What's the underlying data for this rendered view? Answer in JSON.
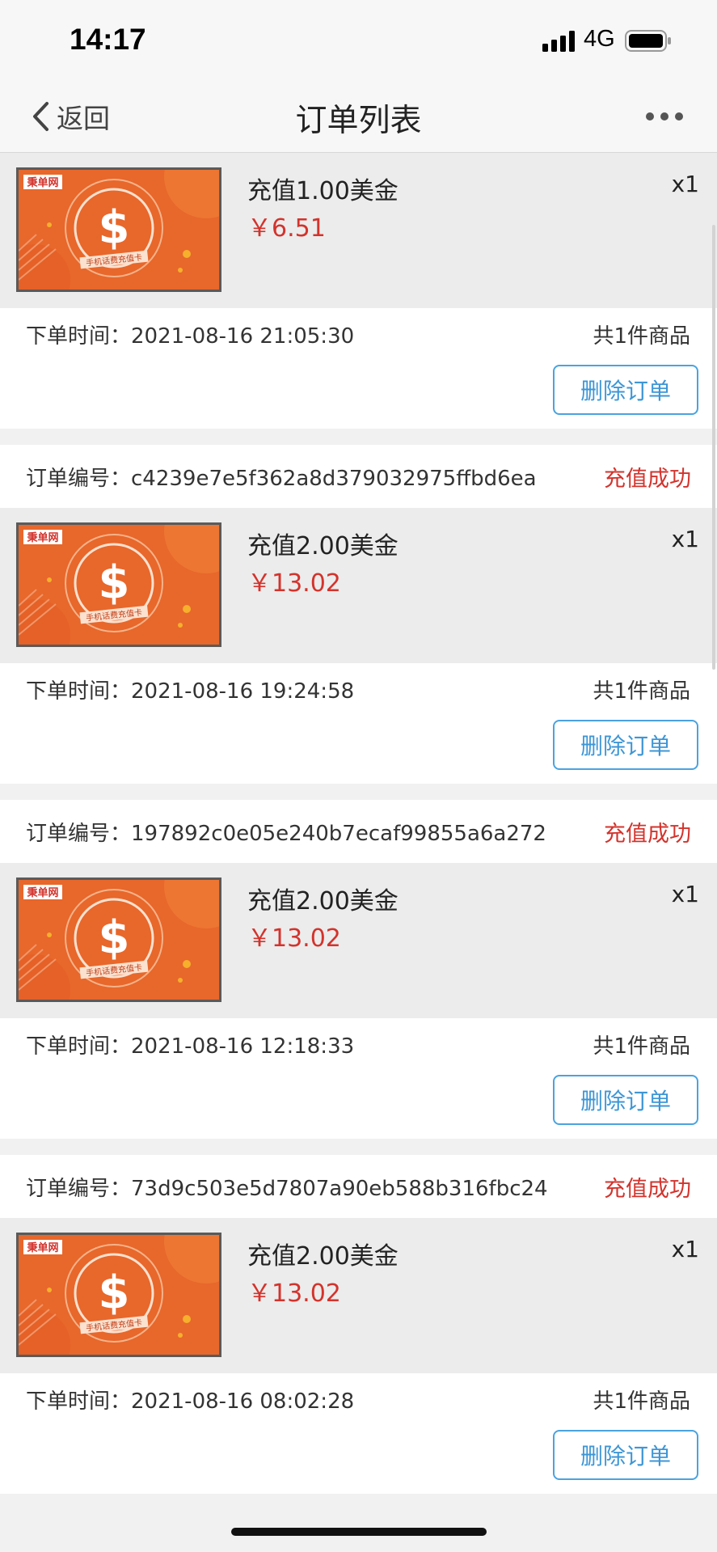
{
  "status_bar": {
    "time": "14:17",
    "network": "4G"
  },
  "nav": {
    "back_label": "返回",
    "title": "订单列表"
  },
  "product_card": {
    "brand": "秉单网",
    "caption": "手机话费充值卡",
    "symbol": "$"
  },
  "orders": [
    {
      "order_no_label": "",
      "order_no": "",
      "status": "",
      "product_name": "充值1.00美金",
      "price": "￥6.51",
      "qty": "x1",
      "time_label": "下单时间：",
      "time": "2021-08-16 21:05:30",
      "count": "共1件商品",
      "delete_label": "删除订单"
    },
    {
      "order_no_label": "订单编号：",
      "order_no": "c4239e7e5f362a8d379032975ffbd6ea",
      "status": "充值成功",
      "product_name": "充值2.00美金",
      "price": "￥13.02",
      "qty": "x1",
      "time_label": "下单时间：",
      "time": "2021-08-16 19:24:58",
      "count": "共1件商品",
      "delete_label": "删除订单"
    },
    {
      "order_no_label": "订单编号：",
      "order_no": "197892c0e05e240b7ecaf99855a6a272",
      "status": "充值成功",
      "product_name": "充值2.00美金",
      "price": "￥13.02",
      "qty": "x1",
      "time_label": "下单时间：",
      "time": "2021-08-16 12:18:33",
      "count": "共1件商品",
      "delete_label": "删除订单"
    },
    {
      "order_no_label": "订单编号：",
      "order_no": "73d9c503e5d7807a90eb588b316fbc24",
      "status": "充值成功",
      "product_name": "充值2.00美金",
      "price": "￥13.02",
      "qty": "x1",
      "time_label": "下单时间：",
      "time": "2021-08-16 08:02:28",
      "count": "共1件商品",
      "delete_label": "删除订单"
    }
  ]
}
